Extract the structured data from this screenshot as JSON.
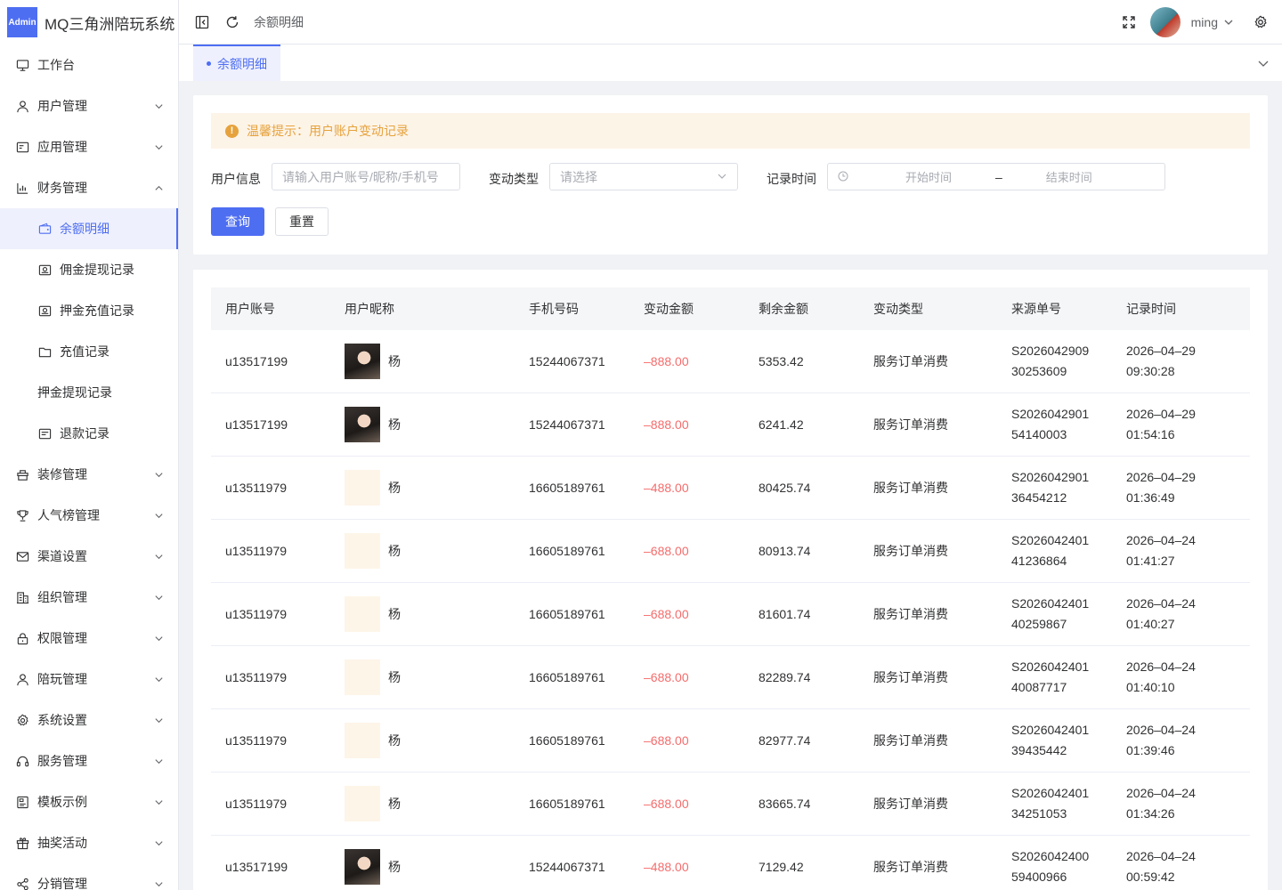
{
  "brand": {
    "logo_text": "Admin",
    "title": "MQ三角洲陪玩系统"
  },
  "sidebar": {
    "items": [
      {
        "label": "工作台",
        "icon": "monitor-icon",
        "arrow": ""
      },
      {
        "label": "用户管理",
        "icon": "user-icon",
        "arrow": "down"
      },
      {
        "label": "应用管理",
        "icon": "app-icon",
        "arrow": "down"
      },
      {
        "label": "财务管理",
        "icon": "chart-icon",
        "arrow": "up"
      },
      {
        "label": "余额明细",
        "icon": "wallet-icon",
        "sub": true,
        "active": true
      },
      {
        "label": "佣金提现记录",
        "icon": "withdraw-icon",
        "sub": true
      },
      {
        "label": "押金充值记录",
        "icon": "recharge-icon",
        "sub": true
      },
      {
        "label": "充值记录",
        "icon": "folder-icon",
        "sub": true
      },
      {
        "label": "押金提现记录",
        "icon": "",
        "sub": true
      },
      {
        "label": "退款记录",
        "icon": "refund-icon",
        "sub": true
      },
      {
        "label": "装修管理",
        "icon": "decor-icon",
        "arrow": "down"
      },
      {
        "label": "人气榜管理",
        "icon": "trophy-icon",
        "arrow": "down"
      },
      {
        "label": "渠道设置",
        "icon": "mail-icon",
        "arrow": "down"
      },
      {
        "label": "组织管理",
        "icon": "building-icon",
        "arrow": "down"
      },
      {
        "label": "权限管理",
        "icon": "lock-icon",
        "arrow": "down"
      },
      {
        "label": "陪玩管理",
        "icon": "user-icon",
        "arrow": "down"
      },
      {
        "label": "系统设置",
        "icon": "gear-icon",
        "arrow": "down"
      },
      {
        "label": "服务管理",
        "icon": "headset-icon",
        "arrow": "down"
      },
      {
        "label": "模板示例",
        "icon": "template-icon",
        "arrow": "down"
      },
      {
        "label": "抽奖活动",
        "icon": "gift-icon",
        "arrow": "down"
      },
      {
        "label": "分销管理",
        "icon": "share-icon",
        "arrow": "down"
      }
    ]
  },
  "header": {
    "breadcrumb": "余额明细",
    "username": "ming"
  },
  "tabs": [
    {
      "label": "余额明细"
    }
  ],
  "alert": {
    "text": "温馨提示：用户账户变动记录"
  },
  "filters": {
    "user_label": "用户信息",
    "user_placeholder": "请输入用户账号/昵称/手机号",
    "type_label": "变动类型",
    "type_placeholder": "请选择",
    "time_label": "记录时间",
    "start_placeholder": "开始时间",
    "range_sep": "–",
    "end_placeholder": "结束时间",
    "search_label": "查询",
    "reset_label": "重置"
  },
  "table": {
    "columns": [
      "用户账号",
      "用户昵称",
      "手机号码",
      "变动金额",
      "剩余金额",
      "变动类型",
      "来源单号",
      "记录时间"
    ],
    "rows": [
      {
        "account": "u13517199",
        "avatar": "photo",
        "nickname": "杨",
        "phone": "15244067371",
        "change": "–888.00",
        "balance": "5353.42",
        "type": "服务订单消费",
        "source1": "S2026042909",
        "source2": "30253609",
        "date": "2026–04–29",
        "time": "09:30:28"
      },
      {
        "account": "u13517199",
        "avatar": "photo",
        "nickname": "杨",
        "phone": "15244067371",
        "change": "–888.00",
        "balance": "6241.42",
        "type": "服务订单消费",
        "source1": "S2026042901",
        "source2": "54140003",
        "date": "2026–04–29",
        "time": "01:54:16"
      },
      {
        "account": "u13511979",
        "avatar": "logo",
        "nickname": "杨",
        "phone": "16605189761",
        "change": "–488.00",
        "balance": "80425.74",
        "type": "服务订单消费",
        "source1": "S2026042901",
        "source2": "36454212",
        "date": "2026–04–29",
        "time": "01:36:49"
      },
      {
        "account": "u13511979",
        "avatar": "logo",
        "nickname": "杨",
        "phone": "16605189761",
        "change": "–688.00",
        "balance": "80913.74",
        "type": "服务订单消费",
        "source1": "S2026042401",
        "source2": "41236864",
        "date": "2026–04–24",
        "time": "01:41:27"
      },
      {
        "account": "u13511979",
        "avatar": "logo",
        "nickname": "杨",
        "phone": "16605189761",
        "change": "–688.00",
        "balance": "81601.74",
        "type": "服务订单消费",
        "source1": "S2026042401",
        "source2": "40259867",
        "date": "2026–04–24",
        "time": "01:40:27"
      },
      {
        "account": "u13511979",
        "avatar": "logo",
        "nickname": "杨",
        "phone": "16605189761",
        "change": "–688.00",
        "balance": "82289.74",
        "type": "服务订单消费",
        "source1": "S2026042401",
        "source2": "40087717",
        "date": "2026–04–24",
        "time": "01:40:10"
      },
      {
        "account": "u13511979",
        "avatar": "logo",
        "nickname": "杨",
        "phone": "16605189761",
        "change": "–688.00",
        "balance": "82977.74",
        "type": "服务订单消费",
        "source1": "S2026042401",
        "source2": "39435442",
        "date": "2026–04–24",
        "time": "01:39:46"
      },
      {
        "account": "u13511979",
        "avatar": "logo",
        "nickname": "杨",
        "phone": "16605189761",
        "change": "–688.00",
        "balance": "83665.74",
        "type": "服务订单消费",
        "source1": "S2026042401",
        "source2": "34251053",
        "date": "2026–04–24",
        "time": "01:34:26"
      },
      {
        "account": "u13517199",
        "avatar": "photo",
        "nickname": "杨",
        "phone": "15244067371",
        "change": "–488.00",
        "balance": "7129.42",
        "type": "服务订单消费",
        "source1": "S2026042400",
        "source2": "59400966",
        "date": "2026–04–24",
        "time": "00:59:42"
      }
    ]
  },
  "colors": {
    "accent": "#4e6ef2",
    "negative": "#f56c6c",
    "warning": "#e6a23c",
    "warning_bg": "#fdf4e8"
  }
}
